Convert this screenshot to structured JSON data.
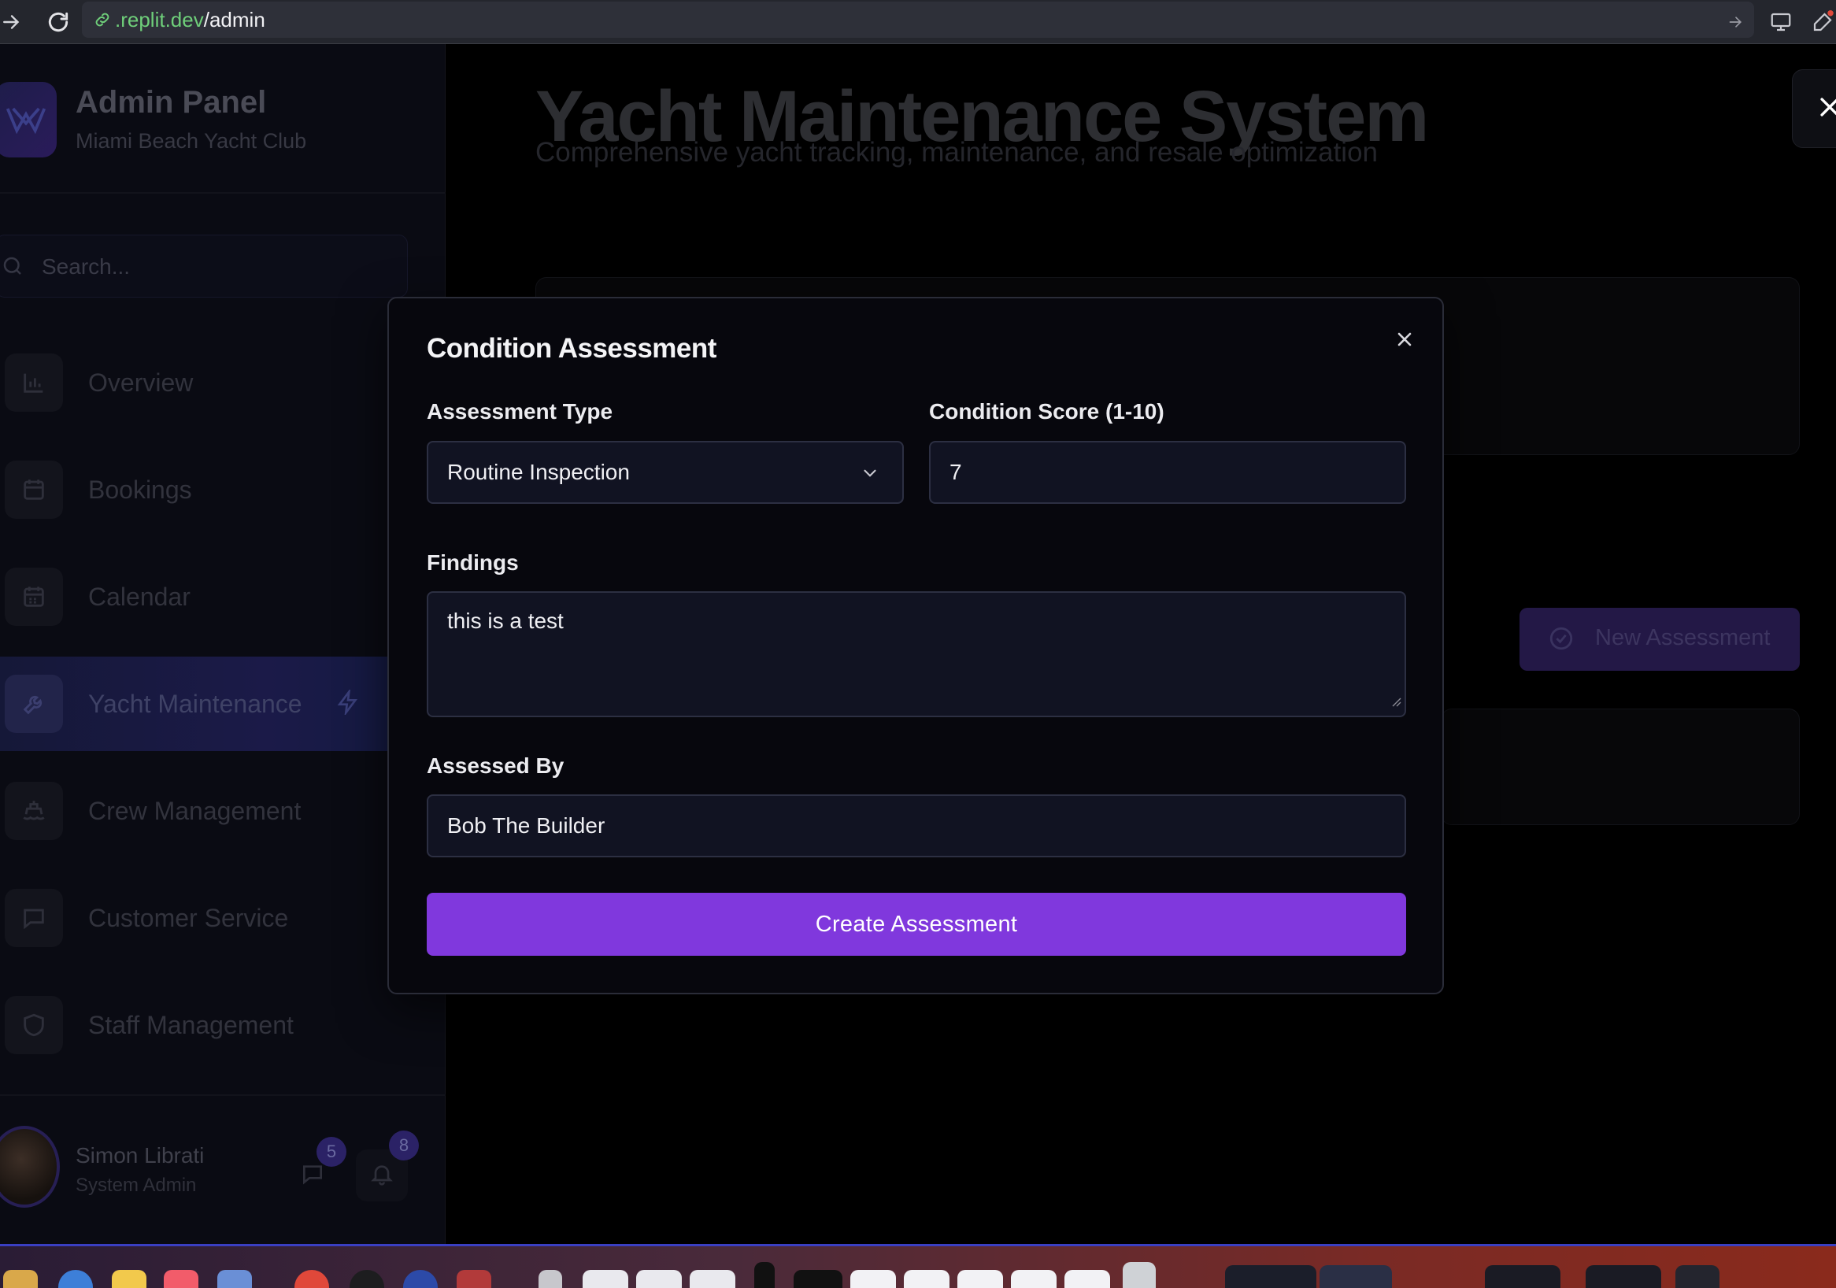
{
  "browser": {
    "url_host": ".replit.dev",
    "url_path": "/admin"
  },
  "sidebar": {
    "brand_title": "Admin Panel",
    "brand_subtitle": "Miami Beach Yacht Club",
    "search_placeholder": "Search...",
    "items": [
      {
        "label": "Overview",
        "icon": "bar-chart-icon"
      },
      {
        "label": "Bookings",
        "icon": "calendar-icon"
      },
      {
        "label": "Calendar",
        "icon": "calendar-grid-icon"
      },
      {
        "label": "Yacht Maintenance",
        "icon": "wrench-icon",
        "active": true
      },
      {
        "label": "Crew Management",
        "icon": "ship-icon"
      },
      {
        "label": "Customer Service",
        "icon": "chat-icon"
      },
      {
        "label": "Staff Management",
        "icon": "shield-icon"
      }
    ],
    "user": {
      "name": "Simon Librati",
      "role": "System Admin",
      "messages_count": "5",
      "notifications_count": "8"
    }
  },
  "main": {
    "title": "Yacht Maintenance System",
    "subtitle": "Comprehensive yacht tracking, maintenance, and resale optimization",
    "new_assessment_label": "New Assessment"
  },
  "modal": {
    "title": "Condition Assessment",
    "assessment_type_label": "Assessment Type",
    "assessment_type_value": "Routine Inspection",
    "condition_score_label": "Condition Score (1-10)",
    "condition_score_value": "7",
    "findings_label": "Findings",
    "findings_value": "this is a test",
    "assessed_by_label": "Assessed By",
    "assessed_by_value": "Bob The Builder",
    "submit_label": "Create Assessment"
  },
  "colors": {
    "accent": "#8038dd",
    "url_host": "#6fcf7a"
  }
}
